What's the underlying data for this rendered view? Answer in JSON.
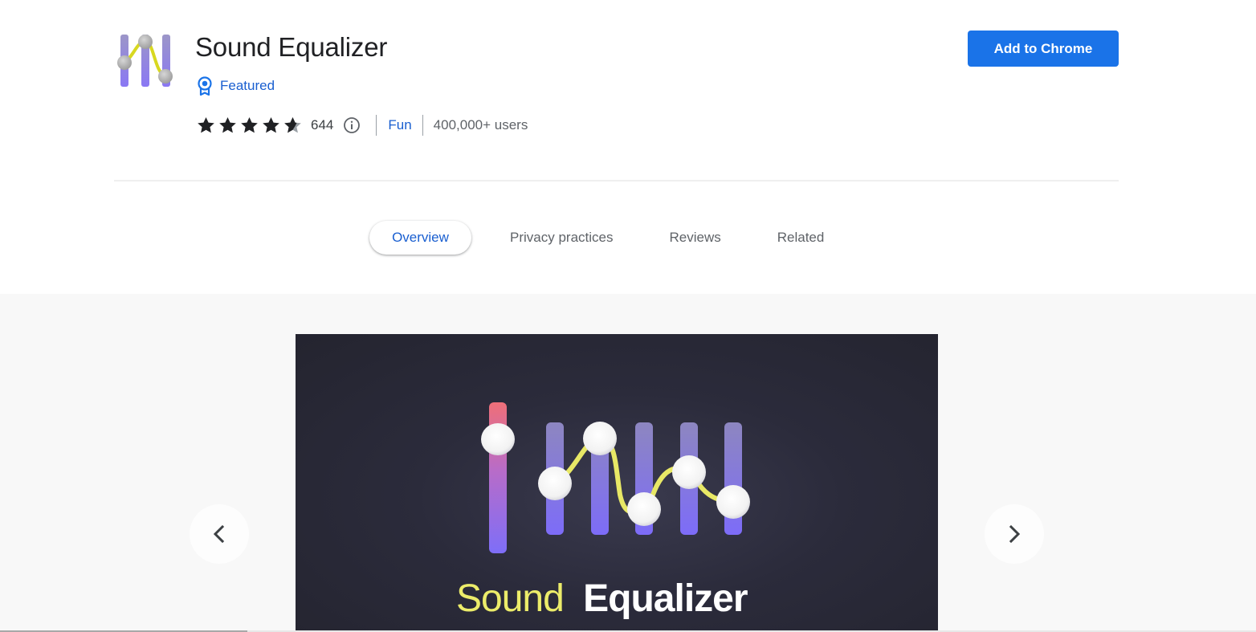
{
  "extension": {
    "title": "Sound Equalizer",
    "badge_label": "Featured",
    "rating": 4.5,
    "rating_count": "644",
    "category": "Fun",
    "users": "400,000+ users",
    "icon": "sound-equalizer-logo"
  },
  "actions": {
    "add_label": "Add to Chrome"
  },
  "tabs": [
    {
      "label": "Overview",
      "active": true
    },
    {
      "label": "Privacy practices",
      "active": false
    },
    {
      "label": "Reviews",
      "active": false
    },
    {
      "label": "Related",
      "active": false
    }
  ],
  "gallery": {
    "slide_text_part1": "Sound",
    "slide_text_part2": "Equalizer",
    "prev_icon": "chevron-left-icon",
    "next_icon": "chevron-right-icon"
  },
  "colors": {
    "accent": "#1a73e8",
    "link": "#1a5fd0",
    "slide_bg": "#2b2b3b",
    "slider_purple": "#7b6cf6",
    "curve_yellow": "#eaea60"
  }
}
